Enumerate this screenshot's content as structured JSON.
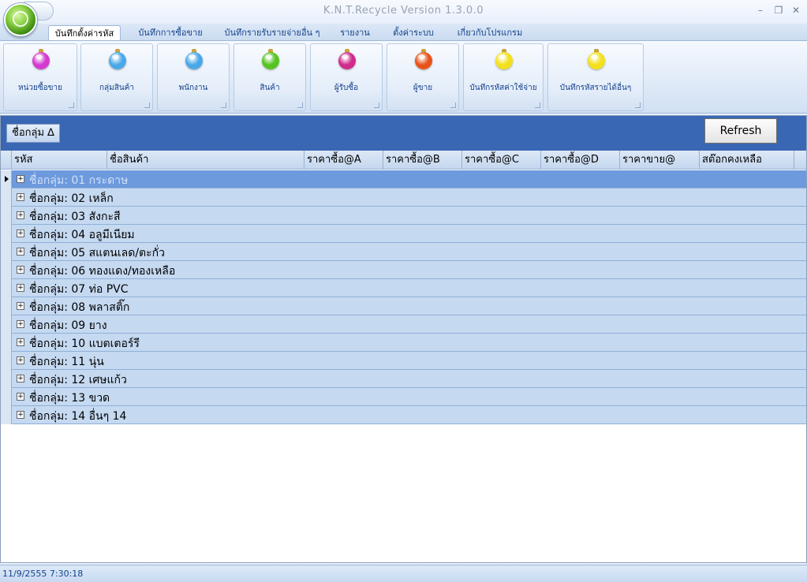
{
  "window": {
    "title": "K.N.T.Recycle Version 1.3.0.0"
  },
  "tabs": [
    {
      "label": "บันทึกตั้งค่ารหัส",
      "active": true
    },
    {
      "label": "บันทึกการซื้อขาย",
      "active": false
    },
    {
      "label": "บันทึกรายรับรายจ่ายอื่น ๆ",
      "active": false
    },
    {
      "label": "รายงาน",
      "active": false
    },
    {
      "label": "ตั้งค่าระบบ",
      "active": false
    },
    {
      "label": "เกี่ยวกับโปรแกรม",
      "active": false
    }
  ],
  "ribbon": {
    "buttons": [
      {
        "label": "หน่วยซื้อขาย",
        "color": "#d43ad0",
        "icon": "ornament-ball-icon"
      },
      {
        "label": "กลุ่มสินค้า",
        "color": "#4aa8e8",
        "icon": "ornament-ball-icon"
      },
      {
        "label": "พนักงาน",
        "color": "#4aa8e8",
        "icon": "ornament-ball-icon"
      },
      {
        "label": "สินค้า",
        "color": "#55c421",
        "icon": "ornament-ball-icon"
      },
      {
        "label": "ผู้รับซื้อ",
        "color": "#d02a8c",
        "icon": "ornament-ball-icon"
      },
      {
        "label": "ผู้ขาย",
        "color": "#e8531a",
        "icon": "ornament-ball-icon"
      },
      {
        "label": "บันทึกรหัสค่าใช้จ่าย",
        "color": "#f2e01c",
        "icon": "ornament-ball-icon"
      },
      {
        "label": "บันทึกรหัสรายได้อื่นๆ",
        "color": "#f2e01c",
        "icon": "ornament-ball-icon"
      }
    ]
  },
  "grid": {
    "group_chip": "ชื่อกลุ่ม ∆",
    "refresh_label": "Refresh",
    "columns": [
      "รหัส",
      "ชื่อสินค้า",
      "ราคาซื้อ@A",
      "ราคาซื้อ@B",
      "ราคาซื้อ@C",
      "ราคาซื้อ@D",
      "ราคาขาย@",
      "สต๊อกคงเหลือ"
    ],
    "groups": [
      "ชื่อกลุ่ม: 01 กระดาษ",
      "ชื่อกลุ่ม: 02 เหล็ก",
      "ชื่อกลุ่ม: 03 สังกะสี",
      "ชื่อกลุ่ม: 04 อลูมีเนียม",
      "ชื่อกลุ่ม: 05 สแตนเลด/ตะกั่ว",
      "ชื่อกลุ่ม: 06 ทองแดง/ทองเหลือ",
      "ชื่อกลุ่ม: 07 ท่อ PVC",
      "ชื่อกลุ่ม: 08 พลาสติ๊ก",
      "ชื่อกลุ่ม: 09 ยาง",
      "ชื่อกลุ่ม: 10 แบตเตอร์รี",
      "ชื่อกลุ่ม: 11 นุ่น",
      "ชื่อกลุ่ม: 12 เศษแก้ว",
      "ชื่อกลุ่ม: 13 ขวด",
      "ชื่อกลุ่ม: 14 อื่นๆ  14"
    ],
    "expand_symbol": "+"
  },
  "status": {
    "text": "11/9/2555 7:30:18"
  }
}
